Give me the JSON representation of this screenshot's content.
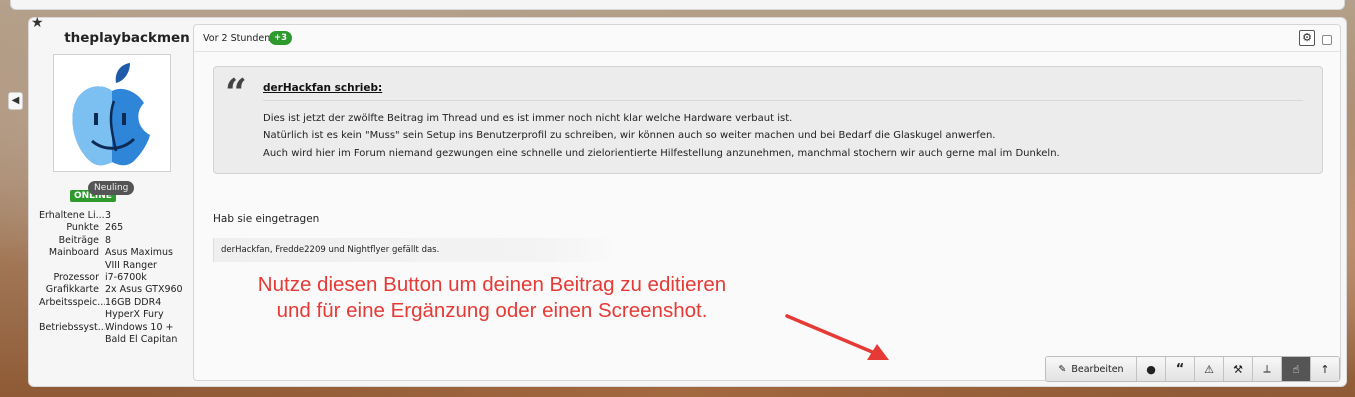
{
  "user": {
    "name": "theplaybackmen",
    "status": "ONLINE",
    "rank": "Neuling",
    "stats": [
      {
        "label": "Erhaltene Li...",
        "value": [
          "3"
        ]
      },
      {
        "label": "Punkte",
        "value": [
          "265"
        ]
      },
      {
        "label": "Beiträge",
        "value": [
          "8"
        ]
      },
      {
        "label": "Mainboard",
        "value": [
          "Asus Maximus",
          "VIII Ranger"
        ]
      },
      {
        "label": "Prozessor",
        "value": [
          "i7-6700k"
        ]
      },
      {
        "label": "Grafikkarte",
        "value": [
          "2x Asus GTX960"
        ]
      },
      {
        "label": "Arbeitsspeic...",
        "value": [
          "16GB DDR4",
          "HyperX Fury"
        ]
      },
      {
        "label": "Betriebssyst...",
        "value": [
          "Windows 10 +",
          "Bald El Capitan"
        ]
      }
    ]
  },
  "post": {
    "time": "Vor 2 Stunden",
    "score": "+3",
    "quote": {
      "author": "derHackfan schrieb:",
      "lines": [
        "Dies ist jetzt der zwölfte Beitrag im Thread und es ist immer noch nicht klar welche Hardware verbaut ist.",
        "Natürlich ist es kein \"Muss\" sein Setup ins Benutzerprofil zu schreiben, wir können auch so weiter machen und bei Bedarf die Glaskugel anwerfen.",
        "Auch wird hier im Forum niemand gezwungen eine schnelle und zielorientierte Hilfestellung anzunehmen, manchmal stochern wir auch gerne mal im Dunkeln."
      ]
    },
    "body": "Hab sie eingetragen",
    "likes": "derHackfan, Fredde2209 und Nightflyer gefällt das."
  },
  "annotation": {
    "line1": "Nutze diesen Button um deinen Beitrag zu editieren",
    "line2": "und für eine Ergänzung oder einen Screenshot."
  },
  "actions": {
    "edit_label": "Bearbeiten",
    "icons": [
      "pencil-icon",
      "globe-icon",
      "quote-icon",
      "warning-icon",
      "hammer-icon",
      "pin-icon",
      "thumbs-up-icon",
      "arrow-up-icon"
    ]
  },
  "colors": {
    "online": "#2e9a2e",
    "annotation": "#e53a36"
  }
}
